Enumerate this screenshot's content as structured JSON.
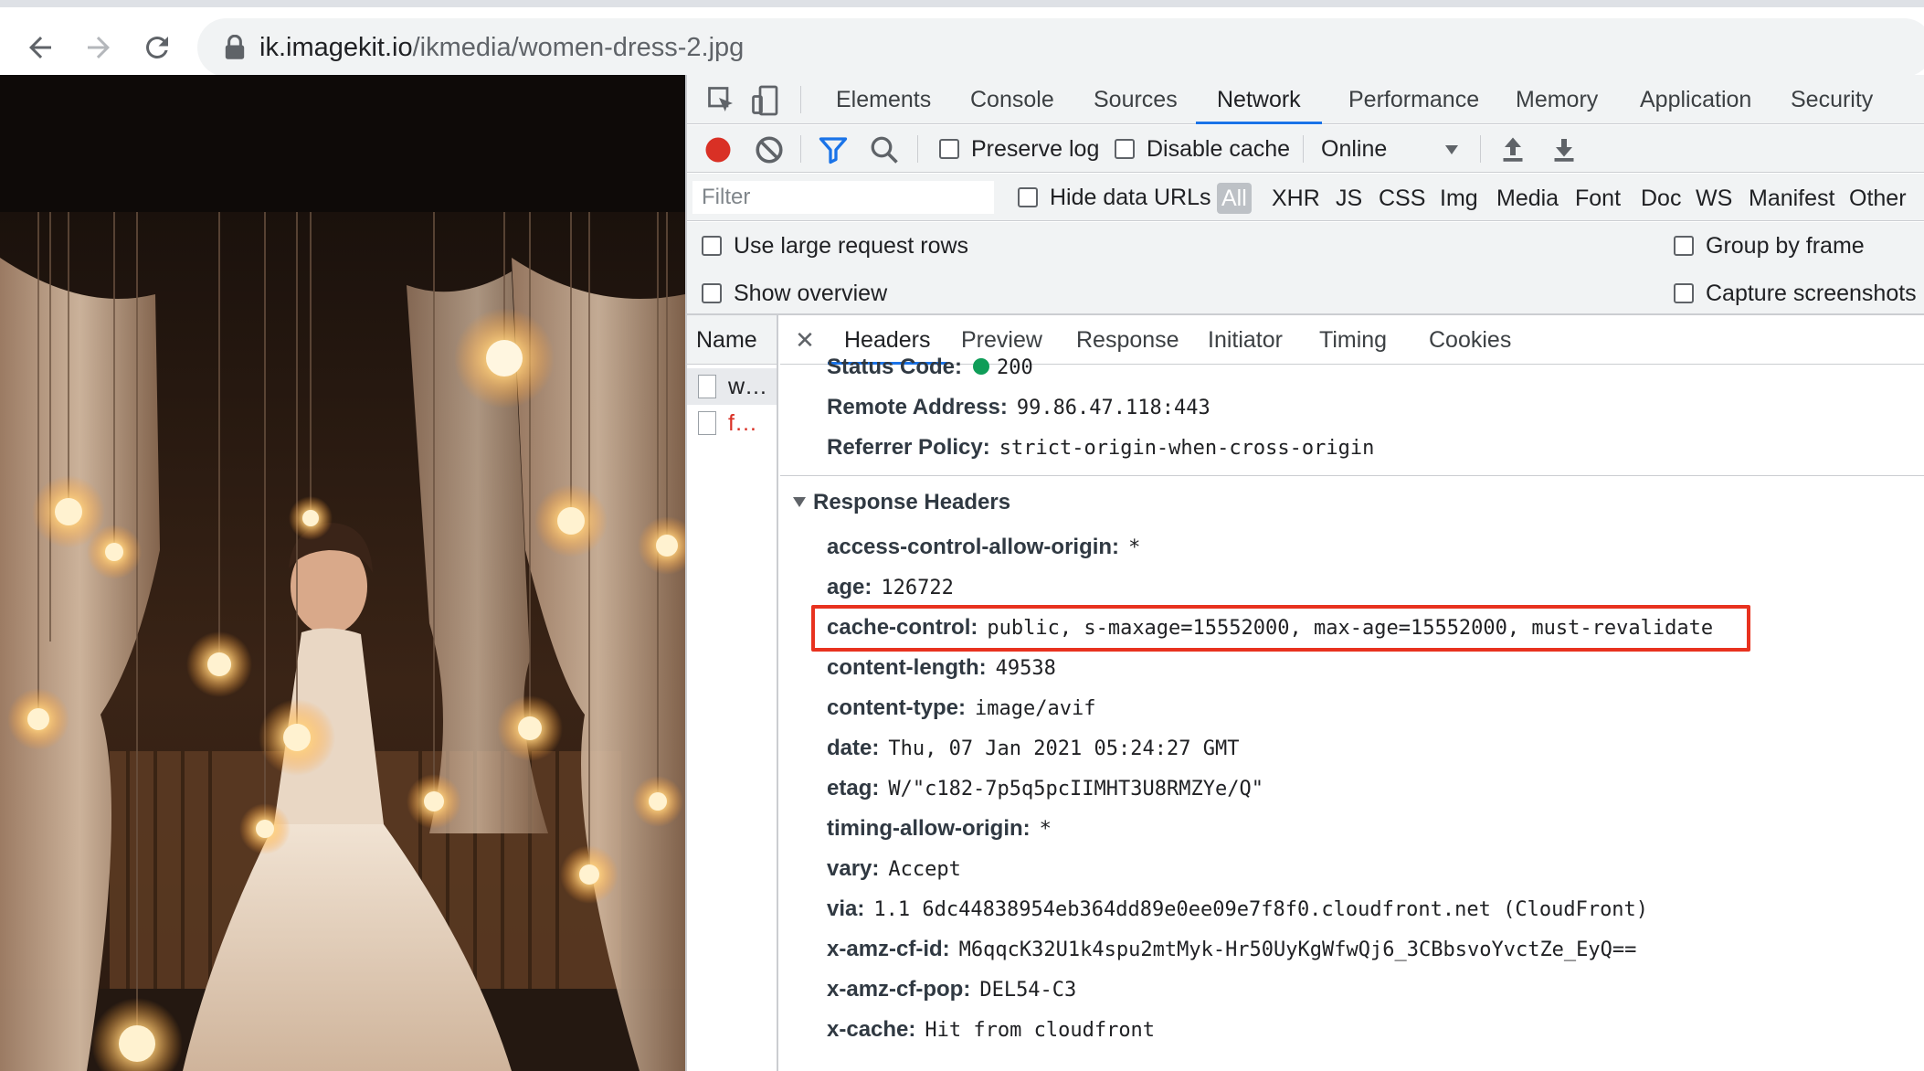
{
  "browser": {
    "url_host": "ik.imagekit.io",
    "url_path": "/ikmedia/women-dress-2.jpg"
  },
  "devtools": {
    "tabs": [
      "Elements",
      "Console",
      "Sources",
      "Network",
      "Performance",
      "Memory",
      "Application",
      "Security"
    ],
    "active_tab": "Network",
    "toolbar": {
      "preserve_log": "Preserve log",
      "disable_cache": "Disable cache",
      "throttling": "Online"
    },
    "filter": {
      "placeholder": "Filter",
      "hide_data_urls": "Hide data URLs",
      "types": [
        "All",
        "XHR",
        "JS",
        "CSS",
        "Img",
        "Media",
        "Font",
        "Doc",
        "WS",
        "Manifest",
        "Other"
      ],
      "active_type": "All"
    },
    "settings": {
      "large_rows": "Use large request rows",
      "overview": "Show overview",
      "group_by_frame": "Group by frame",
      "capture_screenshots": "Capture screenshots"
    },
    "requests": {
      "header": "Name",
      "rows": [
        {
          "name": "w…",
          "color": "#202124"
        },
        {
          "name": "f…",
          "color": "#d93025"
        }
      ]
    },
    "detail_tabs": [
      "Headers",
      "Preview",
      "Response",
      "Initiator",
      "Timing",
      "Cookies"
    ],
    "active_detail_tab": "Headers",
    "general": [
      {
        "key": "Status Code:",
        "value": "200"
      },
      {
        "key": "Remote Address:",
        "value": "99.86.47.118:443"
      },
      {
        "key": "Referrer Policy:",
        "value": "strict-origin-when-cross-origin"
      }
    ],
    "response_headers_title": "Response Headers",
    "response_headers": [
      {
        "key": "access-control-allow-origin:",
        "value": "*"
      },
      {
        "key": "age:",
        "value": "126722"
      },
      {
        "key": "cache-control:",
        "value": "public, s-maxage=15552000, max-age=15552000, must-revalidate"
      },
      {
        "key": "content-length:",
        "value": "49538"
      },
      {
        "key": "content-type:",
        "value": "image/avif"
      },
      {
        "key": "date:",
        "value": "Thu, 07 Jan 2021 05:24:27 GMT"
      },
      {
        "key": "etag:",
        "value": "W/\"c182-7p5q5pcIIMHT3U8RMZYe/Q\""
      },
      {
        "key": "timing-allow-origin:",
        "value": "*"
      },
      {
        "key": "vary:",
        "value": "Accept"
      },
      {
        "key": "via:",
        "value": "1.1 6dc44838954eb364dd89e0ee09e7f8f0.cloudfront.net (CloudFront)"
      },
      {
        "key": "x-amz-cf-id:",
        "value": "M6qqcK32U1k4spu2mtMyk-Hr50UyKgWfwQj6_3CBbsvoYvctZe_EyQ=="
      },
      {
        "key": "x-amz-cf-pop:",
        "value": "DEL54-C3"
      },
      {
        "key": "x-cache:",
        "value": "Hit from cloudfront"
      }
    ],
    "highlighted_header": "cache-control:",
    "highlight_color": "#e8321f",
    "accent_color": "#1a73e8"
  }
}
